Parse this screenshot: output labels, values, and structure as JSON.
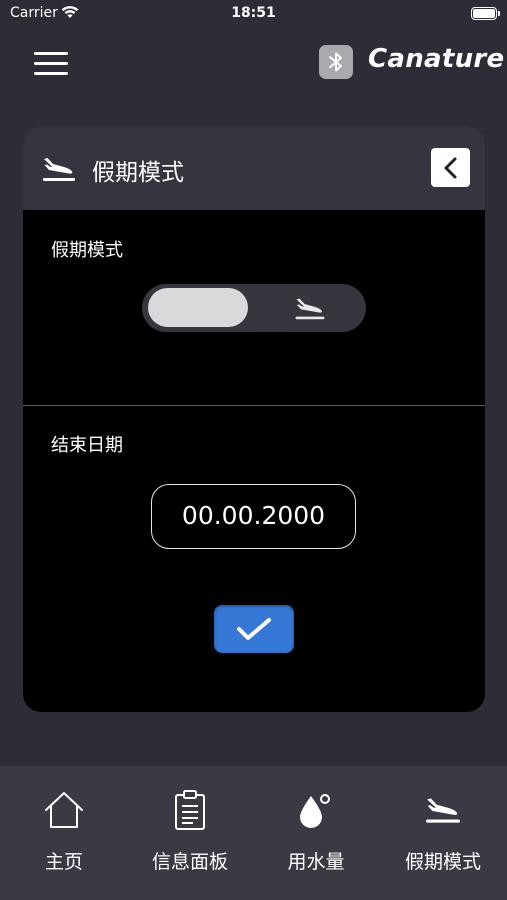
{
  "status": {
    "carrier": "Carrier",
    "time": "18:51"
  },
  "header": {
    "brand": "Canature",
    "icon": "bluetooth-icon"
  },
  "card": {
    "title": "假期模式",
    "mode_section": {
      "label": "假期模式",
      "toggle_on": false
    },
    "date_section": {
      "label": "结束日期",
      "date_value": "00.00.2000"
    },
    "confirm_icon": "checkmark-icon"
  },
  "tabs": [
    {
      "label": "主页",
      "icon": "home-icon"
    },
    {
      "label": "信息面板",
      "icon": "clipboard-icon"
    },
    {
      "label": "用水量",
      "icon": "water-drop-icon"
    },
    {
      "label": "假期模式",
      "icon": "airplane-icon"
    }
  ],
  "colors": {
    "accent": "#3678d6",
    "background": "#2e2d37",
    "card": "#000000",
    "tabbar": "#3a3944"
  }
}
